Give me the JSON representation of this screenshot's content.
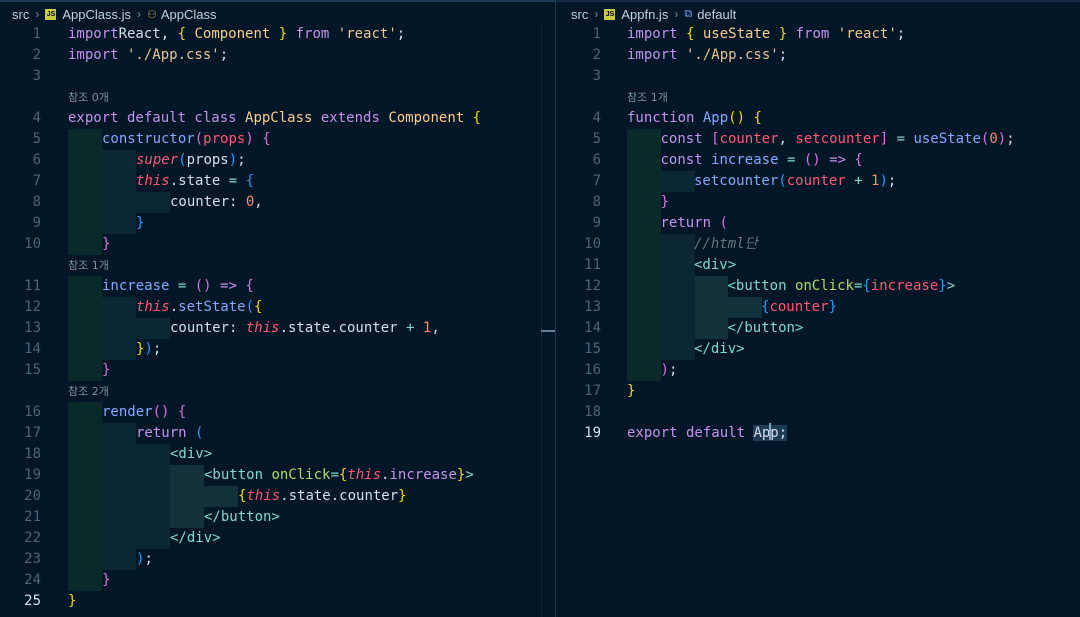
{
  "left_editor": {
    "breadcrumb": {
      "folder": "src",
      "file": "AppClass.js",
      "symbol": "AppClass",
      "file_type": "js-icon",
      "symbol_type": "class-symbol-icon"
    },
    "lenses": {
      "l4": "참조 0개",
      "l11": "참조 1개",
      "l16": "참조 2개"
    },
    "line_numbers": [
      "1",
      "2",
      "3",
      "4",
      "5",
      "6",
      "7",
      "8",
      "9",
      "10",
      "11",
      "12",
      "13",
      "14",
      "15",
      "16",
      "17",
      "18",
      "19",
      "20",
      "21",
      "22",
      "23",
      "24",
      "25"
    ],
    "active_line": "25",
    "lines": {
      "l1": [
        [
          "k",
          "import"
        ],
        [
          " ",
          "React, "
        ],
        [
          "b1",
          "{"
        ],
        [
          "cl",
          " Component "
        ],
        [
          "b1",
          "}"
        ],
        [
          "k",
          " from "
        ],
        [
          "st",
          "'react'"
        ],
        [
          " ",
          ";"
        ]
      ],
      "l2": [
        [
          "k",
          "import"
        ],
        [
          "st",
          " './App.css'"
        ],
        [
          " ",
          ";"
        ]
      ],
      "l3": [],
      "l4": [
        [
          "k",
          "export default class "
        ],
        [
          "cl",
          "AppClass "
        ],
        [
          "k",
          "extends "
        ],
        [
          "cl",
          "Component "
        ],
        [
          "b1",
          "{"
        ]
      ],
      "l5": [
        [
          "fn",
          "constructor"
        ],
        [
          "b2",
          "("
        ],
        [
          "pr",
          "props"
        ],
        [
          "b2",
          ")"
        ],
        [
          " ",
          " "
        ],
        [
          "b2",
          "{"
        ]
      ],
      "l6": [
        [
          "th",
          "super"
        ],
        [
          "b3",
          "("
        ],
        [
          " ",
          "props"
        ],
        [
          "b3",
          ")"
        ],
        [
          " ",
          ";"
        ]
      ],
      "l7": [
        [
          "th",
          "this"
        ],
        [
          " ",
          ".state "
        ],
        [
          "op",
          "="
        ],
        [
          " ",
          " "
        ],
        [
          "b3",
          "{"
        ]
      ],
      "l8": [
        [
          " ",
          "counter: "
        ],
        [
          "nm",
          "0"
        ],
        [
          " ",
          ","
        ]
      ],
      "l9": [
        [
          "b3",
          "}"
        ]
      ],
      "l10": [
        [
          "b2",
          "}"
        ]
      ],
      "l11": [
        [
          "fn",
          "increase "
        ],
        [
          "op",
          "="
        ],
        [
          " ",
          " "
        ],
        [
          "b2",
          "()"
        ],
        [
          " ",
          " "
        ],
        [
          "k",
          "=>"
        ],
        [
          " ",
          " "
        ],
        [
          "b2",
          "{"
        ]
      ],
      "l12": [
        [
          "th",
          "this"
        ],
        [
          " ",
          "."
        ],
        [
          "fn",
          "setState"
        ],
        [
          "b3",
          "("
        ],
        [
          "b1",
          "{"
        ]
      ],
      "l13": [
        [
          " ",
          "counter: "
        ],
        [
          "th",
          "this"
        ],
        [
          " ",
          ".state.counter "
        ],
        [
          "op",
          "+"
        ],
        [
          " ",
          " "
        ],
        [
          "nm",
          "1"
        ],
        [
          " ",
          ","
        ]
      ],
      "l14": [
        [
          "b1",
          "}"
        ],
        [
          "b3",
          ")"
        ],
        [
          " ",
          ";"
        ]
      ],
      "l15": [
        [
          "b2",
          "}"
        ]
      ],
      "l16": [
        [
          "fn",
          "render"
        ],
        [
          "b2",
          "()"
        ],
        [
          " ",
          " "
        ],
        [
          "b2",
          "{"
        ]
      ],
      "l17": [
        [
          "k",
          "return "
        ],
        [
          "b3",
          "("
        ]
      ],
      "l18": [
        [
          "tg",
          "<div>"
        ]
      ],
      "l19": [
        [
          "tg",
          "<button "
        ],
        [
          "at",
          "onClick"
        ],
        [
          "op",
          "="
        ],
        [
          "b1",
          "{"
        ],
        [
          "th",
          "this"
        ],
        [
          " ",
          "."
        ],
        [
          "k",
          "increase"
        ],
        [
          "b1",
          "}"
        ],
        [
          "tg",
          ">"
        ]
      ],
      "l20": [
        [
          "b1",
          "{"
        ],
        [
          "th",
          "this"
        ],
        [
          " ",
          ".state.counter"
        ],
        [
          "b1",
          "}"
        ]
      ],
      "l21": [
        [
          "tg",
          "</button>"
        ]
      ],
      "l22": [
        [
          "tg",
          "</div>"
        ]
      ],
      "l23": [
        [
          "b3",
          ")"
        ],
        [
          " ",
          ";"
        ]
      ],
      "l24": [
        [
          "b2",
          "}"
        ]
      ],
      "l25": [
        [
          "b1",
          "}"
        ]
      ]
    }
  },
  "right_editor": {
    "breadcrumb": {
      "folder": "src",
      "file": "Appfn.js",
      "symbol": "default",
      "file_type": "js-icon",
      "symbol_type": "variable-symbol-icon"
    },
    "lenses": {
      "l4": "참조 1개"
    },
    "line_numbers": [
      "1",
      "2",
      "3",
      "4",
      "5",
      "6",
      "7",
      "8",
      "9",
      "10",
      "11",
      "12",
      "13",
      "14",
      "15",
      "16",
      "17",
      "18",
      "19"
    ],
    "active_line": "19",
    "lines": {
      "l1": [
        [
          "k",
          "import "
        ],
        [
          "b1",
          "{"
        ],
        [
          "cl",
          " useState "
        ],
        [
          "b1",
          "}"
        ],
        [
          "k",
          " from "
        ],
        [
          "st",
          "'react'"
        ],
        [
          " ",
          ";"
        ]
      ],
      "l2": [
        [
          "k",
          "import"
        ],
        [
          "st",
          " './App.css'"
        ],
        [
          " ",
          ";"
        ]
      ],
      "l3": [],
      "l4": [
        [
          "k",
          "function "
        ],
        [
          "fn",
          "App"
        ],
        [
          "b1",
          "()"
        ],
        [
          " ",
          " "
        ],
        [
          "b1",
          "{"
        ]
      ],
      "l5": [
        [
          "k",
          "const "
        ],
        [
          "b2",
          "["
        ],
        [
          "pr",
          "counter"
        ],
        [
          " ",
          ", "
        ],
        [
          "pr",
          "setcounter"
        ],
        [
          "b2",
          "]"
        ],
        [
          " ",
          " "
        ],
        [
          "op",
          "="
        ],
        [
          " ",
          " "
        ],
        [
          "fn",
          "useState"
        ],
        [
          "b2",
          "("
        ],
        [
          "nm",
          "0"
        ],
        [
          "b2",
          ")"
        ],
        [
          " ",
          ";"
        ]
      ],
      "l6": [
        [
          "k",
          "const "
        ],
        [
          "fn",
          "increase "
        ],
        [
          "op",
          "="
        ],
        [
          " ",
          " "
        ],
        [
          "b2",
          "()"
        ],
        [
          " ",
          " "
        ],
        [
          "k",
          "=>"
        ],
        [
          " ",
          " "
        ],
        [
          "b2",
          "{"
        ]
      ],
      "l7": [
        [
          "fn",
          "setcounter"
        ],
        [
          "b3",
          "("
        ],
        [
          "pr",
          "counter "
        ],
        [
          "op",
          "+"
        ],
        [
          " ",
          " "
        ],
        [
          "nm",
          "1"
        ],
        [
          "b3",
          ")"
        ],
        [
          " ",
          ";"
        ]
      ],
      "l8": [
        [
          "b2",
          "}"
        ]
      ],
      "l9": [
        [
          "k",
          "return "
        ],
        [
          "b2",
          "("
        ]
      ],
      "l10": [
        [
          "cm",
          "//html단"
        ]
      ],
      "l11": [
        [
          "tg",
          "<div>"
        ]
      ],
      "l12": [
        [
          "tg",
          "<button "
        ],
        [
          "at",
          "onClick"
        ],
        [
          "op",
          "="
        ],
        [
          "b3",
          "{"
        ],
        [
          "pr",
          "increase"
        ],
        [
          "b3",
          "}"
        ],
        [
          "tg",
          ">"
        ]
      ],
      "l13": [
        [
          "b3",
          "{"
        ],
        [
          "pr",
          "counter"
        ],
        [
          "b3",
          "}"
        ]
      ],
      "l14": [
        [
          "tg",
          "</button>"
        ]
      ],
      "l15": [
        [
          "tg",
          "</div>"
        ]
      ],
      "l16": [
        [
          "b2",
          ")"
        ],
        [
          " ",
          ";"
        ]
      ],
      "l17": [
        [
          "b1",
          "}"
        ]
      ],
      "l18": [],
      "l19": [
        [
          "k",
          "export default "
        ],
        [
          "sel",
          "App"
        ],
        [
          "selsemi",
          ";"
        ]
      ]
    }
  }
}
